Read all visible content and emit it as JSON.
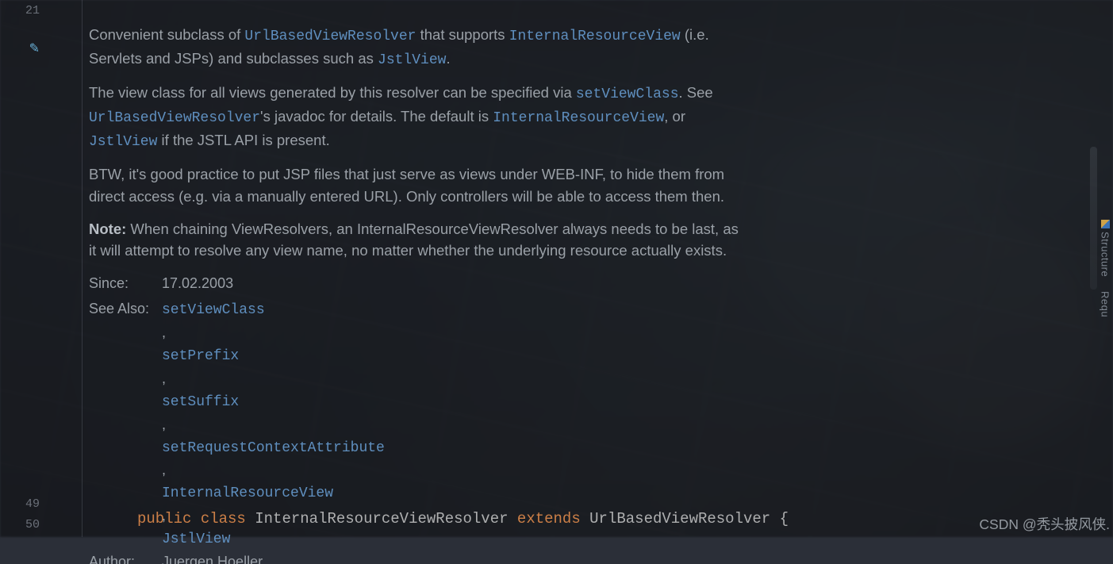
{
  "gutter": {
    "line_a": "21",
    "line_b": "49",
    "line_c": "50"
  },
  "doc": {
    "p1_a": "Convenient subclass of ",
    "p1_link1": "UrlBasedViewResolver",
    "p1_b": " that supports ",
    "p1_link2": "InternalResourceView",
    "p1_c": " (i.e. Servlets and JSPs) and subclasses such as ",
    "p1_link3": "JstlView",
    "p1_d": ".",
    "p2_a": "The view class for all views generated by this resolver can be specified via ",
    "p2_link1": "setViewClass",
    "p2_b": ". See ",
    "p2_link2": "UrlBasedViewResolver",
    "p2_c": "'s javadoc for details. The default is ",
    "p2_link3": "InternalResourceView",
    "p2_d": ", or ",
    "p2_link4": "JstlView",
    "p2_e": " if the JSTL API is present.",
    "p3": "BTW, it's good practice to put JSP files that just serve as views under WEB-INF, to hide them from direct access (e.g. via a manually entered URL). Only controllers will be able to access them then.",
    "p4_note": "Note:",
    "p4_body": " When chaining ViewResolvers, an InternalResourceViewResolver always needs to be last, as it will attempt to resolve any view name, no matter whether the underlying resource actually exists.",
    "since_label": "Since:",
    "since_value": "17.02.2003",
    "seealso_label": "See Also:",
    "seealso": [
      "setViewClass",
      "setPrefix",
      "setSuffix",
      "setRequestContextAttribute",
      "InternalResourceView",
      "JstlView"
    ],
    "author_label": "Author:",
    "author_value": "Juergen Hoeller"
  },
  "code": {
    "kw_public": "public",
    "kw_class": "class",
    "name": "InternalResourceViewResolver",
    "kw_extends": "extends",
    "supername": "UrlBasedViewResolver",
    "brace": "{"
  },
  "sidebar": {
    "structure_label": "Structure",
    "req_label": "Requ"
  },
  "watermark": "CSDN @秃头披风侠."
}
